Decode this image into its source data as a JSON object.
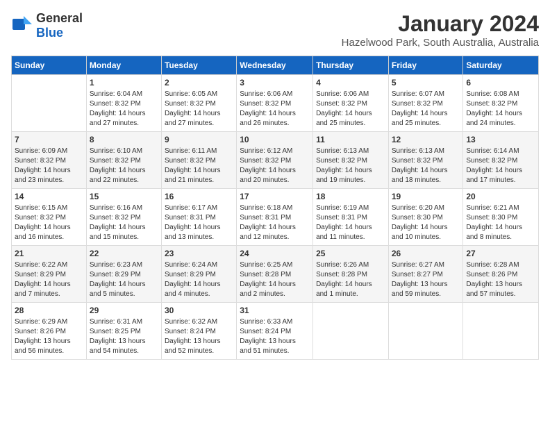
{
  "logo": {
    "general": "General",
    "blue": "Blue"
  },
  "header": {
    "title": "January 2024",
    "subtitle": "Hazelwood Park, South Australia, Australia"
  },
  "days_of_week": [
    "Sunday",
    "Monday",
    "Tuesday",
    "Wednesday",
    "Thursday",
    "Friday",
    "Saturday"
  ],
  "weeks": [
    [
      {
        "day": "",
        "info": ""
      },
      {
        "day": "1",
        "info": "Sunrise: 6:04 AM\nSunset: 8:32 PM\nDaylight: 14 hours\nand 27 minutes."
      },
      {
        "day": "2",
        "info": "Sunrise: 6:05 AM\nSunset: 8:32 PM\nDaylight: 14 hours\nand 27 minutes."
      },
      {
        "day": "3",
        "info": "Sunrise: 6:06 AM\nSunset: 8:32 PM\nDaylight: 14 hours\nand 26 minutes."
      },
      {
        "day": "4",
        "info": "Sunrise: 6:06 AM\nSunset: 8:32 PM\nDaylight: 14 hours\nand 25 minutes."
      },
      {
        "day": "5",
        "info": "Sunrise: 6:07 AM\nSunset: 8:32 PM\nDaylight: 14 hours\nand 25 minutes."
      },
      {
        "day": "6",
        "info": "Sunrise: 6:08 AM\nSunset: 8:32 PM\nDaylight: 14 hours\nand 24 minutes."
      }
    ],
    [
      {
        "day": "7",
        "info": "Sunrise: 6:09 AM\nSunset: 8:32 PM\nDaylight: 14 hours\nand 23 minutes."
      },
      {
        "day": "8",
        "info": "Sunrise: 6:10 AM\nSunset: 8:32 PM\nDaylight: 14 hours\nand 22 minutes."
      },
      {
        "day": "9",
        "info": "Sunrise: 6:11 AM\nSunset: 8:32 PM\nDaylight: 14 hours\nand 21 minutes."
      },
      {
        "day": "10",
        "info": "Sunrise: 6:12 AM\nSunset: 8:32 PM\nDaylight: 14 hours\nand 20 minutes."
      },
      {
        "day": "11",
        "info": "Sunrise: 6:13 AM\nSunset: 8:32 PM\nDaylight: 14 hours\nand 19 minutes."
      },
      {
        "day": "12",
        "info": "Sunrise: 6:13 AM\nSunset: 8:32 PM\nDaylight: 14 hours\nand 18 minutes."
      },
      {
        "day": "13",
        "info": "Sunrise: 6:14 AM\nSunset: 8:32 PM\nDaylight: 14 hours\nand 17 minutes."
      }
    ],
    [
      {
        "day": "14",
        "info": "Sunrise: 6:15 AM\nSunset: 8:32 PM\nDaylight: 14 hours\nand 16 minutes."
      },
      {
        "day": "15",
        "info": "Sunrise: 6:16 AM\nSunset: 8:32 PM\nDaylight: 14 hours\nand 15 minutes."
      },
      {
        "day": "16",
        "info": "Sunrise: 6:17 AM\nSunset: 8:31 PM\nDaylight: 14 hours\nand 13 minutes."
      },
      {
        "day": "17",
        "info": "Sunrise: 6:18 AM\nSunset: 8:31 PM\nDaylight: 14 hours\nand 12 minutes."
      },
      {
        "day": "18",
        "info": "Sunrise: 6:19 AM\nSunset: 8:31 PM\nDaylight: 14 hours\nand 11 minutes."
      },
      {
        "day": "19",
        "info": "Sunrise: 6:20 AM\nSunset: 8:30 PM\nDaylight: 14 hours\nand 10 minutes."
      },
      {
        "day": "20",
        "info": "Sunrise: 6:21 AM\nSunset: 8:30 PM\nDaylight: 14 hours\nand 8 minutes."
      }
    ],
    [
      {
        "day": "21",
        "info": "Sunrise: 6:22 AM\nSunset: 8:29 PM\nDaylight: 14 hours\nand 7 minutes."
      },
      {
        "day": "22",
        "info": "Sunrise: 6:23 AM\nSunset: 8:29 PM\nDaylight: 14 hours\nand 5 minutes."
      },
      {
        "day": "23",
        "info": "Sunrise: 6:24 AM\nSunset: 8:29 PM\nDaylight: 14 hours\nand 4 minutes."
      },
      {
        "day": "24",
        "info": "Sunrise: 6:25 AM\nSunset: 8:28 PM\nDaylight: 14 hours\nand 2 minutes."
      },
      {
        "day": "25",
        "info": "Sunrise: 6:26 AM\nSunset: 8:28 PM\nDaylight: 14 hours\nand 1 minute."
      },
      {
        "day": "26",
        "info": "Sunrise: 6:27 AM\nSunset: 8:27 PM\nDaylight: 13 hours\nand 59 minutes."
      },
      {
        "day": "27",
        "info": "Sunrise: 6:28 AM\nSunset: 8:26 PM\nDaylight: 13 hours\nand 57 minutes."
      }
    ],
    [
      {
        "day": "28",
        "info": "Sunrise: 6:29 AM\nSunset: 8:26 PM\nDaylight: 13 hours\nand 56 minutes."
      },
      {
        "day": "29",
        "info": "Sunrise: 6:31 AM\nSunset: 8:25 PM\nDaylight: 13 hours\nand 54 minutes."
      },
      {
        "day": "30",
        "info": "Sunrise: 6:32 AM\nSunset: 8:24 PM\nDaylight: 13 hours\nand 52 minutes."
      },
      {
        "day": "31",
        "info": "Sunrise: 6:33 AM\nSunset: 8:24 PM\nDaylight: 13 hours\nand 51 minutes."
      },
      {
        "day": "",
        "info": ""
      },
      {
        "day": "",
        "info": ""
      },
      {
        "day": "",
        "info": ""
      }
    ]
  ]
}
